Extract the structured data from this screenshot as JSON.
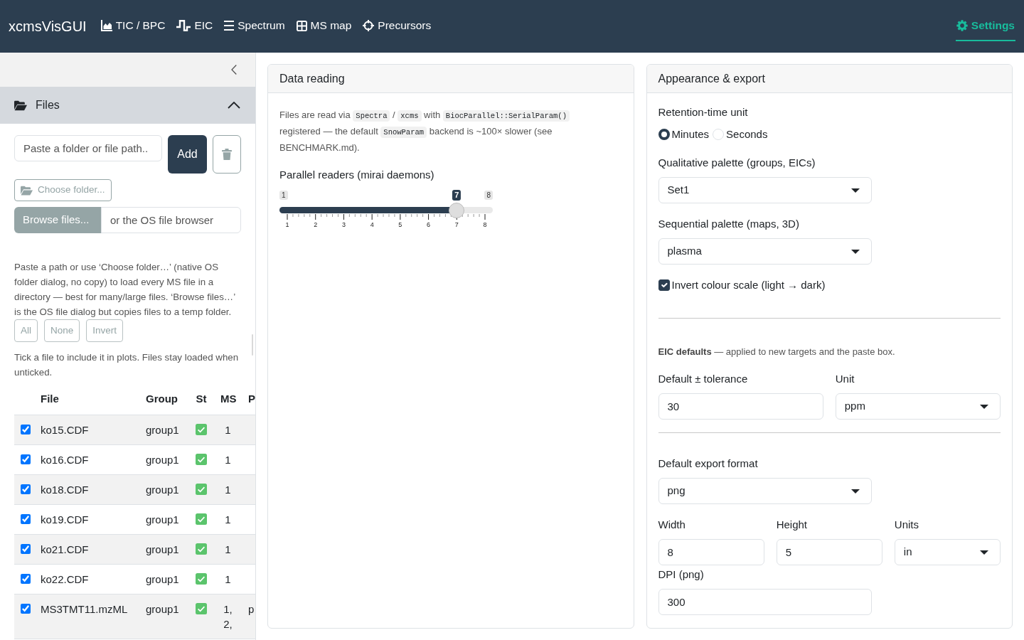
{
  "navbar": {
    "brand": "xcmsVisGUI",
    "items": [
      {
        "label": "TIC / BPC",
        "selected": false
      },
      {
        "label": "EIC",
        "selected": false
      },
      {
        "label": "Spectrum",
        "selected": false
      },
      {
        "label": "MS map",
        "selected": false
      },
      {
        "label": "Precursors",
        "selected": false
      },
      {
        "label": "Settings",
        "selected": true
      }
    ]
  },
  "sidebar": {
    "files_panel": {
      "title": "Files",
      "expanded": true,
      "path_field": {
        "placeholder": "Paste a folder or file path.."
      },
      "add_button": "Add",
      "choose_folder_button": "Choose folder...",
      "browse": {
        "button": "Browse files...",
        "placeholder": "or the OS file browser"
      },
      "help_text": "Paste a path or use ‘Choose folder…’ (native OS folder dialog, no copy) to load every MS file in a directory — best for many/large files. ‘Browse files…’ is the OS file dialog but copies files to a temp folder.",
      "selection_buttons": [
        "All",
        "None",
        "Invert"
      ],
      "note": "Tick a file to include it in plots. Files stay loaded when unticked.",
      "table": {
        "columns": [
          "File",
          "Group",
          "St",
          "MS",
          "P"
        ],
        "rows": [
          {
            "checked": true,
            "file": "ko15.CDF",
            "group": "group1",
            "loaded": true,
            "ms": "1"
          },
          {
            "checked": true,
            "file": "ko16.CDF",
            "group": "group1",
            "loaded": true,
            "ms": "1"
          },
          {
            "checked": true,
            "file": "ko18.CDF",
            "group": "group1",
            "loaded": true,
            "ms": "1"
          },
          {
            "checked": true,
            "file": "ko19.CDF",
            "group": "group1",
            "loaded": true,
            "ms": "1"
          },
          {
            "checked": true,
            "file": "ko21.CDF",
            "group": "group1",
            "loaded": true,
            "ms": "1"
          },
          {
            "checked": true,
            "file": "ko22.CDF",
            "group": "group1",
            "loaded": true,
            "ms": "1"
          },
          {
            "checked": true,
            "file": "MS3TMT11.mzML",
            "group": "group1",
            "loaded": true,
            "ms": "1, 2,",
            "column_5": "p"
          }
        ]
      }
    }
  },
  "data_reading": {
    "title": "Data reading",
    "description": [
      {
        "kind": "text",
        "text": "Files are read via "
      },
      {
        "kind": "code",
        "text": "Spectra"
      },
      {
        "kind": "text",
        "text": " / "
      },
      {
        "kind": "code",
        "text": "xcms"
      },
      {
        "kind": "text",
        "text": " with "
      },
      {
        "kind": "code",
        "text": "BiocParallel::SerialParam()"
      },
      {
        "kind": "text",
        "text": " registered — the default "
      },
      {
        "kind": "code",
        "text": "SnowParam"
      },
      {
        "kind": "text",
        "text": " backend is ~100× slower (see BENCHMARK.md)."
      }
    ],
    "slider": {
      "label": "Parallel readers (mirai daemons)",
      "min_label": "1",
      "max_label": "8",
      "value_label": "7",
      "level": 0.857,
      "tick_labels": [
        "1",
        "2",
        "3",
        "4",
        "5",
        "6",
        "7",
        "8"
      ]
    }
  },
  "appearance": {
    "title": "Appearance & export",
    "rt_unit": {
      "label": "Retention-time unit",
      "options": [
        {
          "label": "Minutes",
          "selected": true
        },
        {
          "label": "Seconds",
          "selected": false
        }
      ]
    },
    "qualitative_palette": {
      "label": "Qualitative palette (groups, EICs)",
      "value": "Set1"
    },
    "sequential_palette": {
      "label": "Sequential palette (maps, 3D)",
      "value": "plasma"
    },
    "invert_scale": {
      "label": "Invert colour scale (light → dark)",
      "checked": true
    },
    "eic_note": "**EIC defaults** — applied to new targets and the paste box.",
    "tolerance": {
      "label": "Default ± tolerance",
      "value": "30"
    },
    "unit": {
      "label": "Unit",
      "value": "ppm"
    },
    "export_format": {
      "label": "Default export format",
      "value": "png"
    },
    "width": {
      "label": "Width",
      "value": "8"
    },
    "height": {
      "label": "Height",
      "value": "5"
    },
    "units": {
      "label": "Units",
      "value": "in"
    },
    "dpi": {
      "label": "DPI (png)",
      "value": "300"
    }
  }
}
